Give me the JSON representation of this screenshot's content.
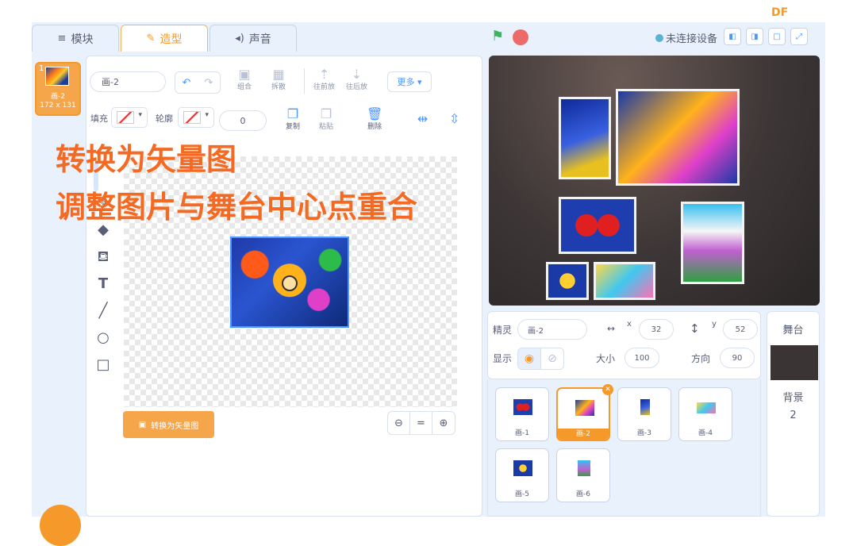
{
  "brand": "DF",
  "tabs": [
    {
      "label": "模块",
      "icon": "code-icon"
    },
    {
      "label": "造型",
      "icon": "brush-icon"
    },
    {
      "label": "声音",
      "icon": "speaker-icon"
    }
  ],
  "costume": {
    "index": "1",
    "name": "画-2",
    "size": "172 x 131"
  },
  "editor": {
    "name_value": "画-2",
    "tools": [
      "组合",
      "拆散",
      "往前放",
      "往后放"
    ],
    "more": "更多",
    "fill_label": "填充",
    "outline_label": "轮廓",
    "outline_width": "0",
    "actions": [
      "复制",
      "粘贴",
      "删除"
    ],
    "convert": "转换为矢量图"
  },
  "overlay": {
    "line1": "转换为矢量图",
    "line2": "调整图片与舞台中心点重合"
  },
  "stage_header": {
    "connection": "未连接设备"
  },
  "sprite_info": {
    "sprite_label": "精灵",
    "sprite_name": "画-2",
    "x_label": "x",
    "x": "32",
    "y_label": "y",
    "y": "52",
    "show_label": "显示",
    "size_label": "大小",
    "size": "100",
    "direction_label": "方向",
    "direction": "90"
  },
  "sprites": [
    "画-1",
    "画-2",
    "画-3",
    "画-4",
    "画-5",
    "画-6"
  ],
  "stage_panel": {
    "title": "舞台",
    "backdrop_label": "背景",
    "backdrop_count": "2"
  },
  "colors": {
    "accent": "#f59a2a",
    "blue": "#4c97ff",
    "overlay_text": "#f46a22"
  }
}
